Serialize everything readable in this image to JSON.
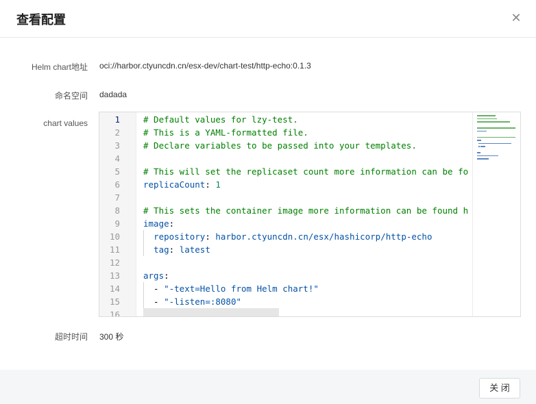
{
  "dialog": {
    "title": "查看配置",
    "close_icon": "close-icon"
  },
  "fields": {
    "helm_chart_label": "Helm chart地址",
    "helm_chart_value": "oci://harbor.ctyuncdn.cn/esx-dev/chart-test/http-echo:0.1.3",
    "namespace_label": "命名空间",
    "namespace_value": "dadada",
    "chart_values_label": "chart values",
    "timeout_label": "超时时间",
    "timeout_value": "300 秒"
  },
  "editor": {
    "line_numbers": [
      "1",
      "2",
      "3",
      "4",
      "5",
      "6",
      "7",
      "8",
      "9",
      "10",
      "11",
      "12",
      "13",
      "14",
      "15",
      "16"
    ],
    "active_line": "1",
    "lines": [
      [
        {
          "t": "comment",
          "v": "# Default values for lzy-test."
        }
      ],
      [
        {
          "t": "comment",
          "v": "# This is a YAML-formatted file."
        }
      ],
      [
        {
          "t": "comment",
          "v": "# Declare variables to be passed into your templates."
        }
      ],
      [],
      [
        {
          "t": "comment",
          "v": "# This will set the replicaset count more information can be fo"
        }
      ],
      [
        {
          "t": "key",
          "v": "replicaCount"
        },
        {
          "t": "plain",
          "v": ": "
        },
        {
          "t": "num",
          "v": "1"
        }
      ],
      [],
      [
        {
          "t": "comment",
          "v": "# This sets the container image more information can be found h"
        }
      ],
      [
        {
          "t": "key",
          "v": "image"
        },
        {
          "t": "plain",
          "v": ":"
        }
      ],
      [
        {
          "t": "plain",
          "v": "  "
        },
        {
          "t": "key",
          "v": "repository"
        },
        {
          "t": "plain",
          "v": ": "
        },
        {
          "t": "key",
          "v": "harbor.ctyuncdn.cn/esx/hashicorp/http-echo"
        }
      ],
      [
        {
          "t": "plain",
          "v": "  "
        },
        {
          "t": "key",
          "v": "tag"
        },
        {
          "t": "plain",
          "v": ": "
        },
        {
          "t": "key",
          "v": "latest"
        }
      ],
      [],
      [
        {
          "t": "key",
          "v": "args"
        },
        {
          "t": "plain",
          "v": ":"
        }
      ],
      [
        {
          "t": "plain",
          "v": "  - "
        },
        {
          "t": "key",
          "v": "\"-text=Hello from Helm chart!\""
        }
      ],
      [
        {
          "t": "plain",
          "v": "  - "
        },
        {
          "t": "key",
          "v": "\"-listen=:8080\""
        }
      ],
      []
    ]
  },
  "footer": {
    "close_label": "关 闭"
  }
}
